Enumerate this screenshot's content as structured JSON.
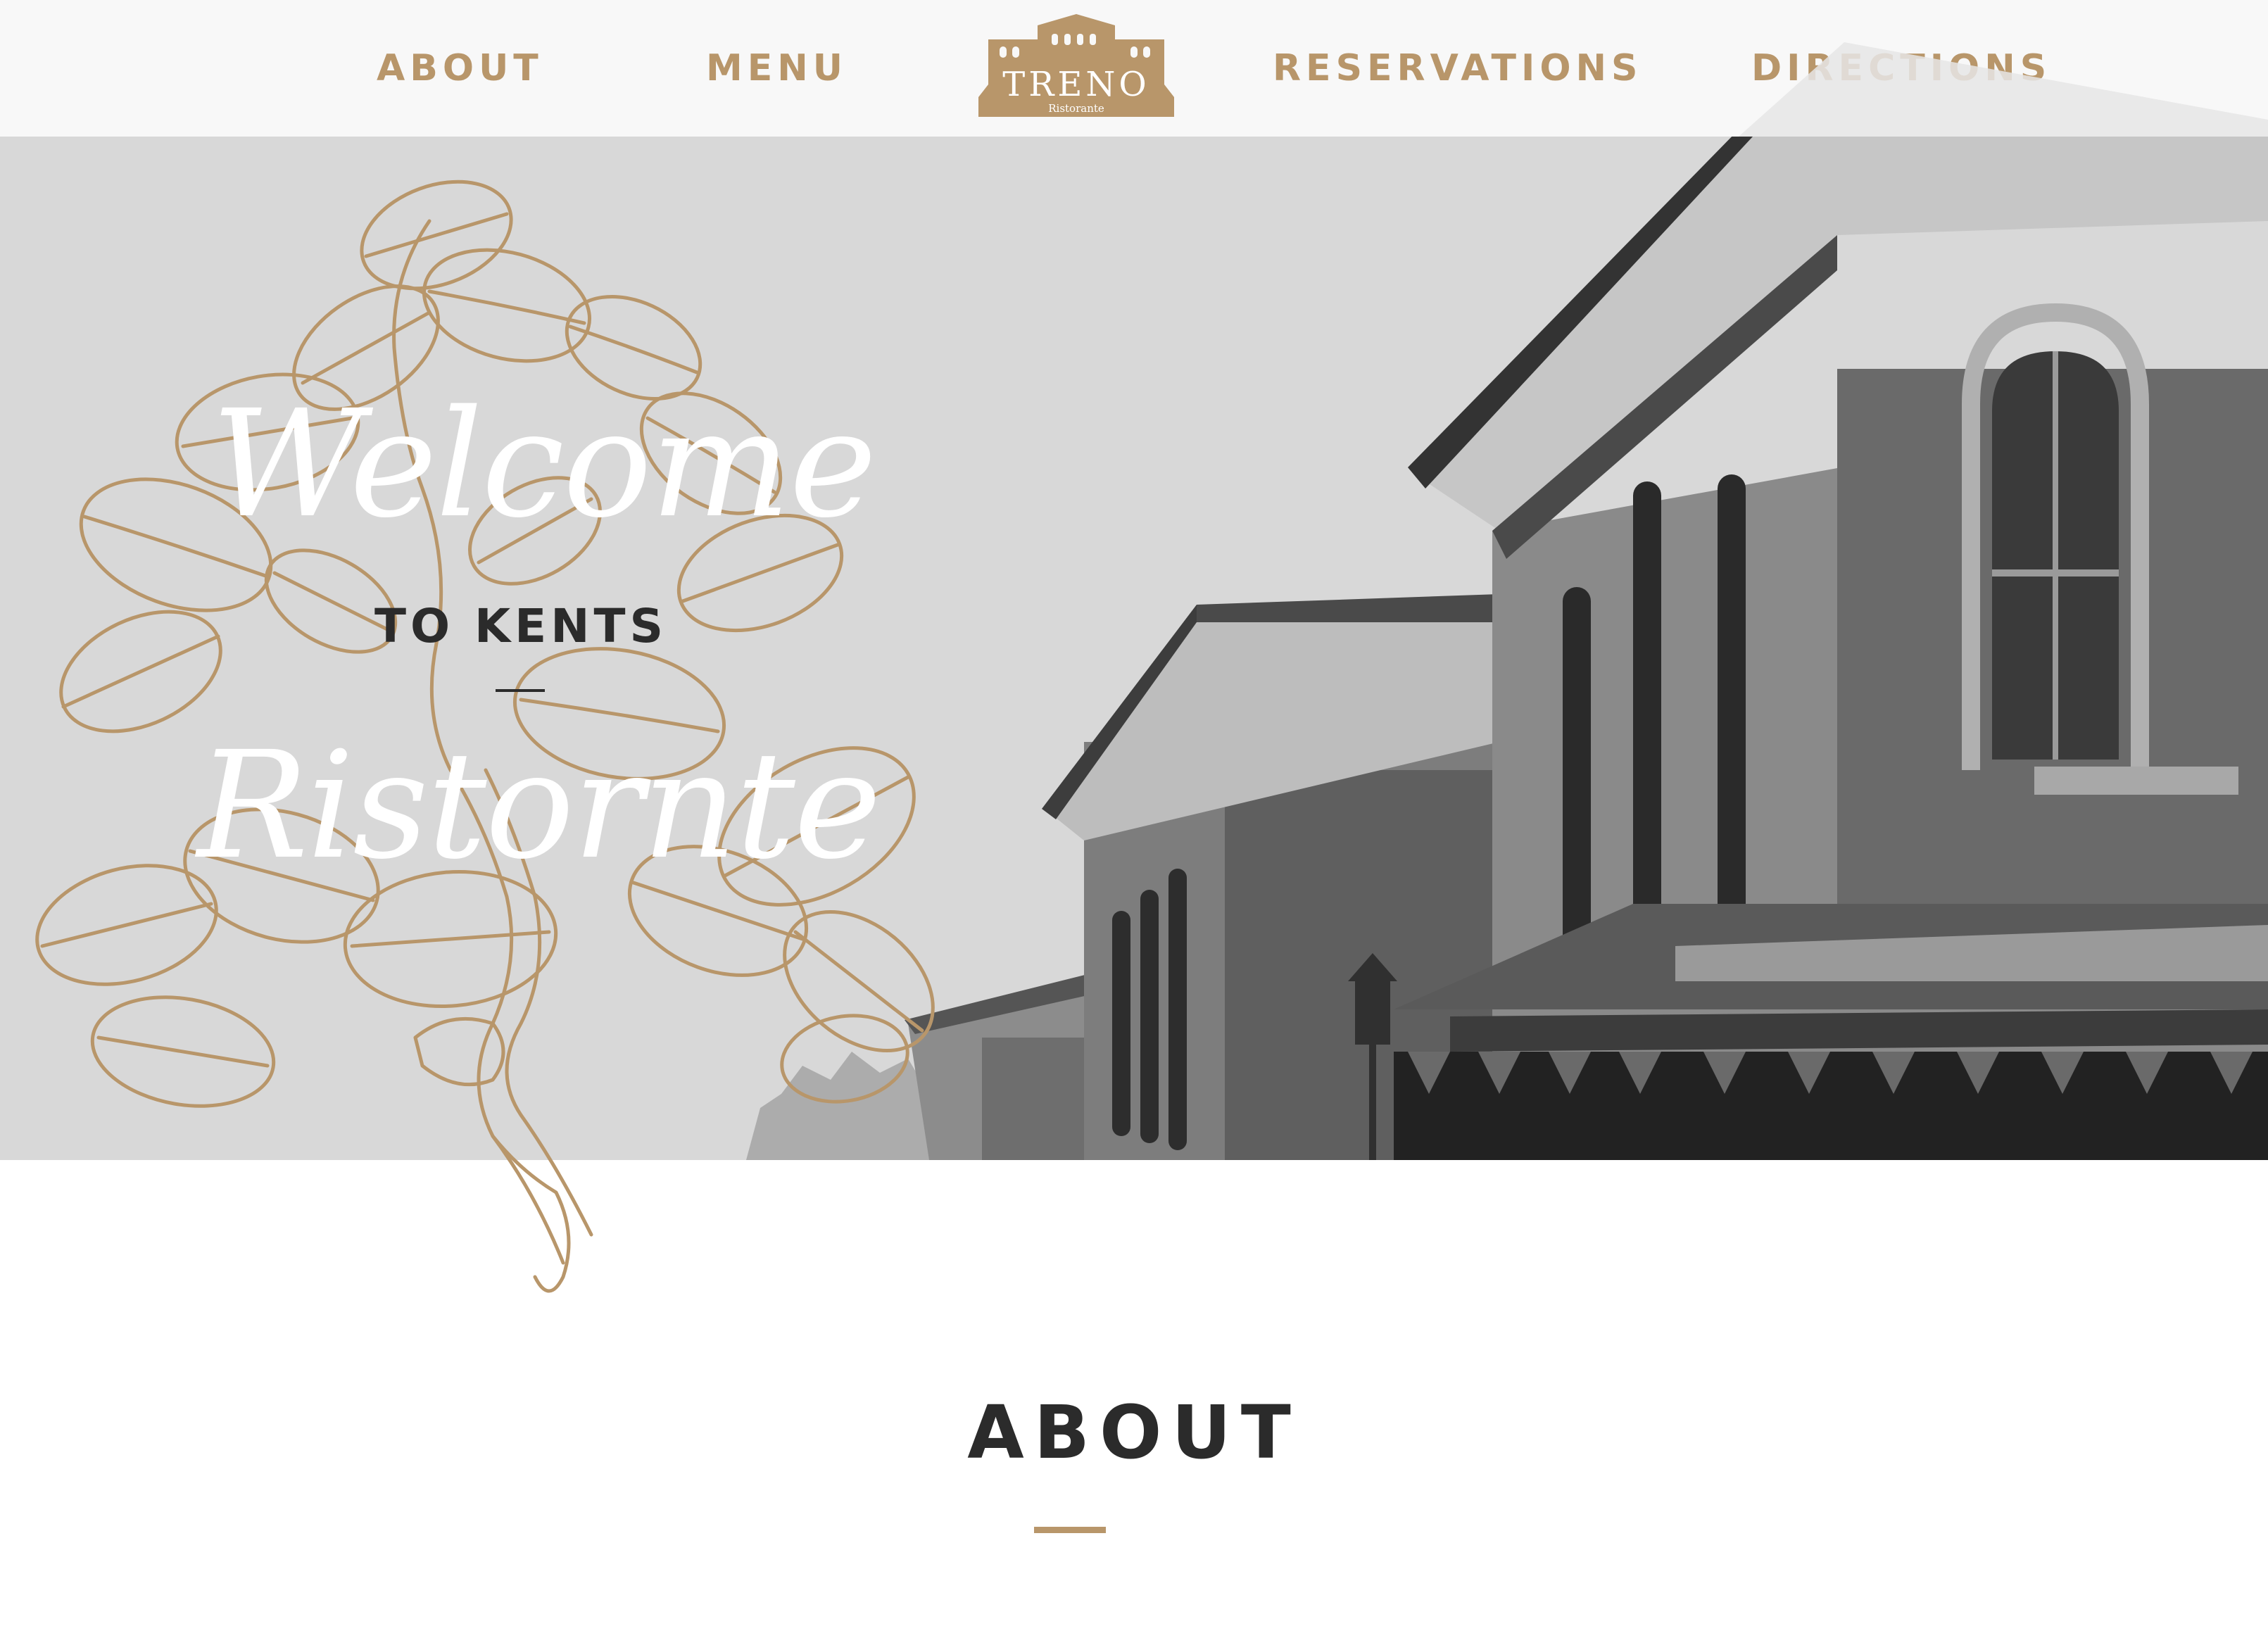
{
  "nav": {
    "about": "ABOUT",
    "menu": "MENU",
    "reservations": "RESERVATIONS",
    "directions": "DIRECTIONS"
  },
  "logo": {
    "name": "TRENO",
    "sub": "Ristorante"
  },
  "hero": {
    "welcome": "Welcome",
    "to_kents": "TO KENTS",
    "ristorante": "Ristornte"
  },
  "about": {
    "title": "ABOUT"
  },
  "colors": {
    "accent": "#b8966a",
    "dark_text": "#2b2b2b",
    "hero_bg": "#d8d8d8",
    "nav_bg": "#f8f8f8"
  }
}
